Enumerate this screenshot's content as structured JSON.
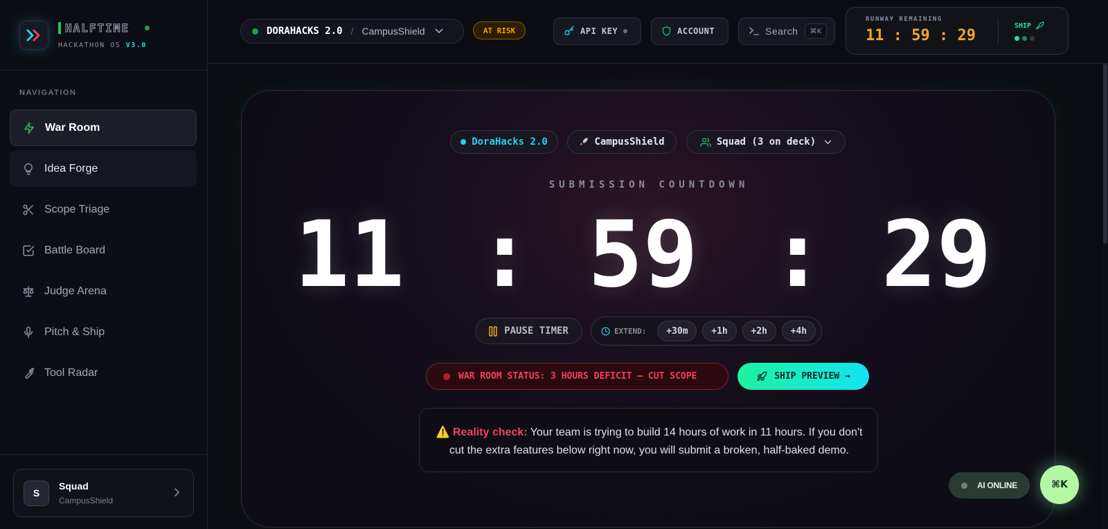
{
  "brand": {
    "title": "HALFTIME",
    "subtitle": "HACKATHON OS",
    "version": "V3.0"
  },
  "sidebar": {
    "heading": "NAVIGATION",
    "items": [
      {
        "label": "War Room",
        "icon": "bolt-icon",
        "state": "active"
      },
      {
        "label": "Idea Forge",
        "icon": "lightbulb-icon",
        "state": "hover"
      },
      {
        "label": "Scope Triage",
        "icon": "scissors-icon",
        "state": "default"
      },
      {
        "label": "Battle Board",
        "icon": "checkbox-icon",
        "state": "default"
      },
      {
        "label": "Judge Arena",
        "icon": "scale-icon",
        "state": "default"
      },
      {
        "label": "Pitch & Ship",
        "icon": "microphone-icon",
        "state": "default"
      },
      {
        "label": "Tool Radar",
        "icon": "wrench-icon",
        "state": "default"
      }
    ],
    "squad": {
      "avatar": "S",
      "name": "Squad",
      "project": "CampusShield"
    }
  },
  "topbar": {
    "hackathon": "DORAHACKS 2.0",
    "separator": "/",
    "project": "CampusShield",
    "risk_badge": "AT RISK",
    "api_key_label": "API KEY",
    "account_label": "ACCOUNT",
    "search_label": "Search",
    "search_shortcut": "⌘K",
    "runway_label": "RUNWAY REMAINING",
    "runway_time": "11 : 59 : 29",
    "ship_label": "SHIP"
  },
  "hero": {
    "chip_hackathon": "DoraHacks 2.0",
    "chip_project": "CampusShield",
    "chip_squad": "Squad (3 on deck)",
    "countdown_label": "SUBMISSION COUNTDOWN",
    "hours": "11",
    "minutes": "59",
    "seconds": "29",
    "separator": ":",
    "pause_label": "PAUSE TIMER",
    "extend_label": "EXTEND:",
    "extend_options": [
      "+30m",
      "+1h",
      "+2h",
      "+4h"
    ],
    "status_text": "WAR ROOM STATUS: 3 HOURS DEFICIT — CUT SCOPE",
    "ship_preview_label": "SHIP PREVIEW →",
    "reality_warn": "⚠️",
    "reality_lead": "Reality check:",
    "reality_body": " Your team is trying to build 14 hours of work in 11 hours. If you don't cut the extra features below right now, you will submit a broken, half-baked demo."
  },
  "floating": {
    "ai_status": "AI ONLINE",
    "command_shortcut": "⌘K"
  },
  "colors": {
    "accent_green": "#22c55e",
    "accent_cyan": "#22d3ee",
    "warning_amber": "#f5a524",
    "danger_red": "#f43f5e"
  }
}
